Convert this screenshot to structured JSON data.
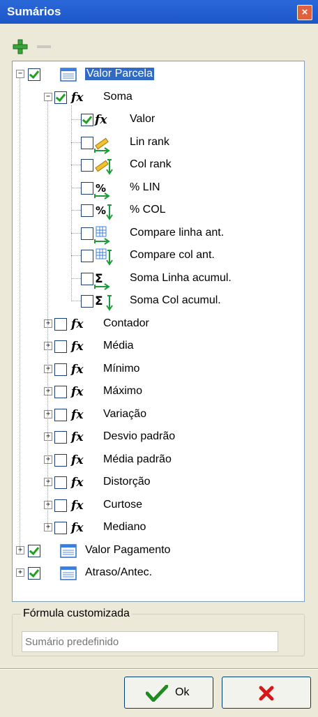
{
  "window": {
    "title": "Sumários",
    "close_symbol": "×"
  },
  "toolbar": {
    "add_icon": "plus-icon",
    "remove_icon": "minus-icon"
  },
  "tree": {
    "root": {
      "label": "Valor Parcela",
      "checked": true,
      "expanded": true
    },
    "soma": {
      "label": "Soma",
      "checked": true,
      "expanded": true
    },
    "soma_children": [
      {
        "label": "Valor",
        "checked": true,
        "icon": "fx-icon"
      },
      {
        "label": "Lin rank",
        "checked": false,
        "icon": "ruler-right-icon"
      },
      {
        "label": "Col rank",
        "checked": false,
        "icon": "ruler-down-icon"
      },
      {
        "label": "% LIN",
        "checked": false,
        "icon": "percent-right-icon"
      },
      {
        "label": "% COL",
        "checked": false,
        "icon": "percent-down-icon"
      },
      {
        "label": "Compare linha ant.",
        "checked": false,
        "icon": "grid-right-icon"
      },
      {
        "label": "Compare col ant.",
        "checked": false,
        "icon": "grid-down-icon"
      },
      {
        "label": "Soma Linha acumul.",
        "checked": false,
        "icon": "sigma-right-icon"
      },
      {
        "label": "Soma Col acumul.",
        "checked": false,
        "icon": "sigma-down-icon"
      }
    ],
    "functions": [
      {
        "label": "Contador"
      },
      {
        "label": "Média"
      },
      {
        "label": "Mínimo"
      },
      {
        "label": "Máximo"
      },
      {
        "label": "Variação"
      },
      {
        "label": "Desvio padrão"
      },
      {
        "label": "Média padrão"
      },
      {
        "label": "Distorção"
      },
      {
        "label": "Curtose"
      },
      {
        "label": "Mediano"
      }
    ],
    "other_roots": [
      {
        "label": "Valor Pagamento",
        "checked": true
      },
      {
        "label": "Atraso/Antec.",
        "checked": true
      }
    ],
    "expand_symbol": "+",
    "collapse_symbol": "−",
    "fx_glyph": "fx"
  },
  "formula": {
    "group_label": "Fórmula customizada",
    "placeholder": "Sumário predefinido",
    "value": ""
  },
  "buttons": {
    "ok_label": "Ok",
    "ok_icon": "checkmark-icon",
    "cancel_icon": "red-x-icon"
  }
}
